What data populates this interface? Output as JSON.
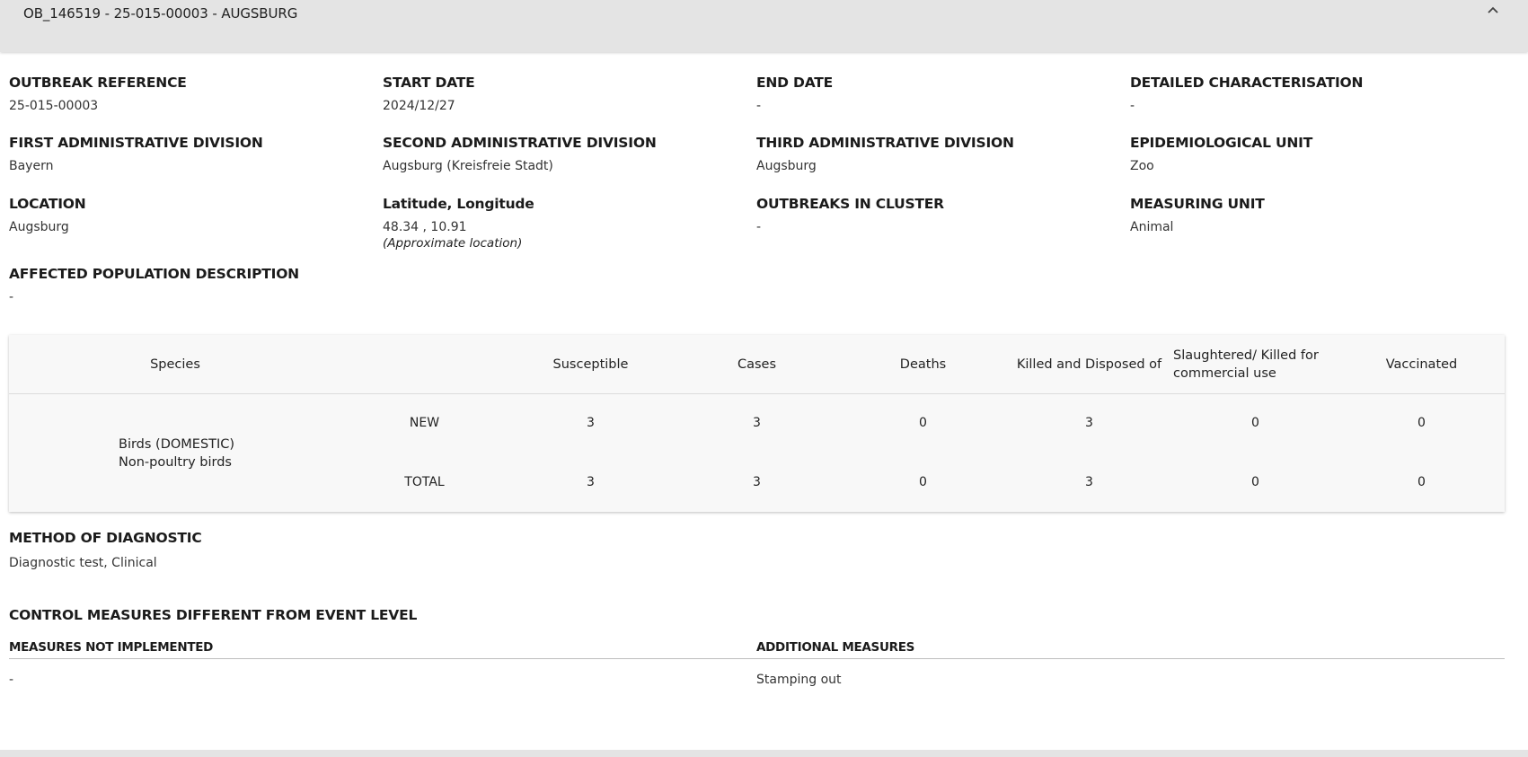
{
  "header": {
    "title": "OB_146519 - 25-015-00003 - AUGSBURG",
    "collapse_icon": "chevron-up-icon"
  },
  "fields": {
    "outbreak_reference": {
      "label": "OUTBREAK REFERENCE",
      "value": "25-015-00003"
    },
    "start_date": {
      "label": "START DATE",
      "value": "2024/12/27"
    },
    "end_date": {
      "label": "END DATE",
      "value": "-"
    },
    "detailed_characterisation": {
      "label": "DETAILED CHARACTERISATION",
      "value": "-"
    },
    "first_admin": {
      "label": "FIRST ADMINISTRATIVE DIVISION",
      "value": "Bayern"
    },
    "second_admin": {
      "label": "SECOND ADMINISTRATIVE DIVISION",
      "value": "Augsburg (Kreisfreie Stadt)"
    },
    "third_admin": {
      "label": "THIRD ADMINISTRATIVE DIVISION",
      "value": "Augsburg"
    },
    "epi_unit": {
      "label": "EPIDEMIOLOGICAL UNIT",
      "value": "Zoo"
    },
    "location": {
      "label": "LOCATION",
      "value": "Augsburg"
    },
    "lat_long": {
      "label": "Latitude, Longitude",
      "value": "48.34 , 10.91",
      "note": "(Approximate location)"
    },
    "outbreaks_in_cluster": {
      "label": "OUTBREAKS IN CLUSTER",
      "value": "-"
    },
    "measuring_unit": {
      "label": "MEASURING UNIT",
      "value": "Animal"
    },
    "affected_population": {
      "label": "AFFECTED POPULATION DESCRIPTION",
      "value": "-"
    }
  },
  "table": {
    "headers": {
      "species": "Species",
      "susceptible": "Susceptible",
      "cases": "Cases",
      "deaths": "Deaths",
      "killed": "Killed and Disposed of",
      "slaughtered": "Slaughtered/ Killed for commercial use",
      "vaccinated": "Vaccinated"
    },
    "species_line1": "Birds (DOMESTIC)",
    "species_line2": "Non-poultry birds",
    "rows": [
      {
        "type": "NEW",
        "susceptible": "3",
        "cases": "3",
        "deaths": "0",
        "killed": "3",
        "slaughtered": "0",
        "vaccinated": "0"
      },
      {
        "type": "TOTAL",
        "susceptible": "3",
        "cases": "3",
        "deaths": "0",
        "killed": "3",
        "slaughtered": "0",
        "vaccinated": "0"
      }
    ]
  },
  "diagnostic": {
    "label": "METHOD OF DIAGNOSTIC",
    "value": "Diagnostic test, Clinical"
  },
  "control": {
    "title": "CONTROL MEASURES DIFFERENT FROM EVENT LEVEL",
    "not_implemented_label": "MEASURES NOT IMPLEMENTED",
    "not_implemented_value": "-",
    "additional_label": "ADDITIONAL MEASURES",
    "additional_value": "Stamping out"
  }
}
